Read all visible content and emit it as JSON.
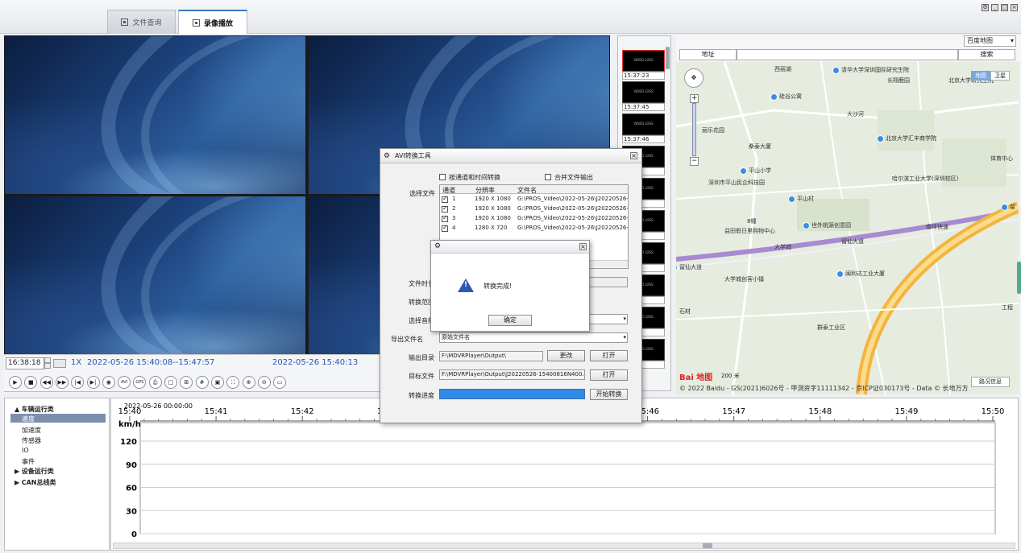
{
  "tabs": [
    {
      "label": "文件查询",
      "icon": "file-search-icon"
    },
    {
      "label": "录像播放",
      "icon": "video-playback-icon"
    }
  ],
  "player": {
    "time_value": "16:38:18",
    "speed": "1X",
    "range": "2022-05-26 15:40:08--15:47:57",
    "current": "2022-05-26 15:40:13"
  },
  "controls": [
    "play-icon",
    "stop-icon",
    "rewind-icon",
    "fast-forward-icon",
    "step-back-icon",
    "step-forward-icon",
    "snapshot-icon",
    "avi-icon",
    "gps-icon",
    "print-icon",
    "single-view-icon",
    "quad-view-icon",
    "nine-view-icon",
    "full-window-icon",
    "fullscreen-icon",
    "zoom-in-icon",
    "zoom-out-icon",
    "record-mark-icon"
  ],
  "controls_text": {
    "avi": "AVI",
    "gps": "GPS"
  },
  "thumbs": [
    "15:37:23",
    "15:37:45",
    "15:37:46",
    "6",
    "3",
    "4",
    "6",
    "7",
    "8",
    "1"
  ],
  "thumb_caption": "VIDEO LOSS",
  "map": {
    "provider": "百度地图",
    "address_label": "地址",
    "search_label": "搜索",
    "map_type": "地图",
    "satellite": "卫星",
    "traffic": "路况信息",
    "scale": "200 米",
    "logo": "Bai 地图",
    "copyright": "© 2022 Baidu - GS(2021)6026号 - 甲测资字11111342 - 京ICP证030173号 - Data © 长地万方",
    "labels": [
      "西丽湖",
      "清华大学深圳国际研究生院",
      "长翔鹿园",
      "北京大学研究生院",
      "硅谷公寓",
      "大沙河",
      "丽乐花园",
      "北京大学汇丰商学院",
      "桑泰大厦",
      "体育中心",
      "平山小学",
      "哈尔滨工业大学(深圳校区)",
      "深圳市平山民企科技园",
      "平山村",
      "8幢",
      "益田假日里购物中心",
      "世外桃源创意园",
      "大学城",
      "留仙大道",
      "留仙大道",
      "南坪快速",
      "大学城创客小镇",
      "闽利达工业大厦",
      "石材",
      "群泰工业区",
      "留",
      "工程"
    ]
  },
  "dialog": {
    "title": "AVI转换工具",
    "opt_channel_time": "按通道和时间转换",
    "opt_merge": "合并文件输出",
    "select_file": "选择文件",
    "columns": [
      "通道",
      "分辨率",
      "文件名"
    ],
    "rows": [
      {
        "ch": "1",
        "res": "1920 X 1080",
        "file": "G:\\PROS_Video\\2022-05-26\\J20220526-15"
      },
      {
        "ch": "2",
        "res": "1920 X 1080",
        "file": "G:\\PROS_Video\\2022-05-26\\J20220526-15"
      },
      {
        "ch": "3",
        "res": "1920 X 1080",
        "file": "G:\\PROS_Video\\2022-05-26\\J20220526-15"
      },
      {
        "ch": "4",
        "res": "1280 X 720",
        "file": "G:\\PROS_Video\\2022-05-26\\J20220526-15"
      }
    ],
    "file_time": "文件时长",
    "convert_range": "转换范围",
    "select_audio": "选择音频",
    "export_name_label": "导出文件名",
    "export_name_value": "原始文件名",
    "output_dir_label": "输出目录",
    "output_dir_value": "F:\\MDVRPlayer\\Output\\",
    "change_btn": "更改",
    "open_btn": "打开",
    "target_label": "目标文件",
    "target_value": "F:\\MDVRPlayer\\Output\\J20220526-15400816N400.mp4",
    "open_btn2": "打开",
    "progress_label": "转换进度",
    "progress_pct": 100,
    "start_btn": "开始转换"
  },
  "message": {
    "text": "转换完成!",
    "ok": "确定"
  },
  "tree": {
    "items": [
      {
        "label": "车辆运行类",
        "arrow": "▲"
      },
      {
        "label": "速度"
      },
      {
        "label": "加速度"
      },
      {
        "label": "传感器"
      },
      {
        "label": "IO"
      },
      {
        "label": "事件"
      },
      {
        "label": "设备运行类",
        "arrow": "▶"
      },
      {
        "label": "CAN总线类",
        "arrow": "▶"
      }
    ]
  },
  "chart_data": {
    "type": "line",
    "title": "",
    "start_label": "2022-05-26 00:00:00",
    "ylabel": "km/h",
    "y_ticks": [
      "120",
      "90",
      "60",
      "30",
      "0"
    ],
    "x_ticks": [
      "15:40",
      "15:41",
      "15:42",
      "15:43",
      "15:44",
      "15:45",
      "15:46",
      "15:47",
      "15:48",
      "15:49",
      "15:50"
    ],
    "series": []
  }
}
